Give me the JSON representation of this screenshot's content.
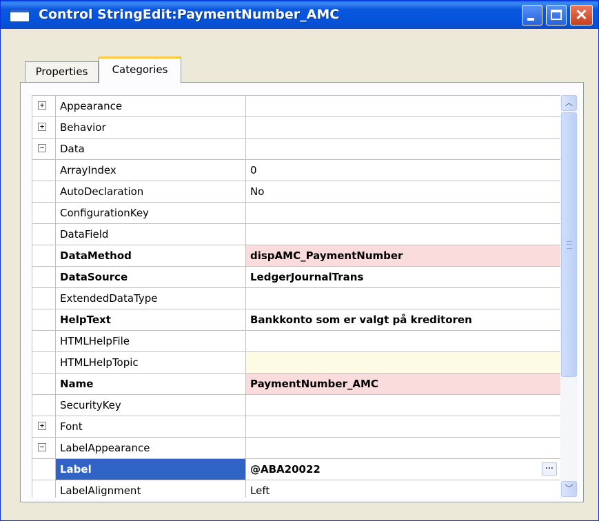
{
  "window": {
    "title": "Control StringEdit:PaymentNumber_AMC"
  },
  "tabs": [
    {
      "label": "Properties"
    },
    {
      "label": "Categories"
    }
  ],
  "rows": [
    {
      "toggle": "+",
      "name": "Appearance",
      "value": ""
    },
    {
      "toggle": "+",
      "name": "Behavior",
      "value": ""
    },
    {
      "toggle": "−",
      "name": "Data",
      "value": ""
    },
    {
      "toggle": "",
      "name": "ArrayIndex",
      "value": "0"
    },
    {
      "toggle": "",
      "name": "AutoDeclaration",
      "value": "No"
    },
    {
      "toggle": "",
      "name": "ConfigurationKey",
      "value": ""
    },
    {
      "toggle": "",
      "name": "DataField",
      "value": ""
    },
    {
      "toggle": "",
      "name": "DataMethod",
      "value": "dispAMC_PaymentNumber",
      "bold": true,
      "highlight": "pink"
    },
    {
      "toggle": "",
      "name": "DataSource",
      "value": "LedgerJournalTrans",
      "bold": true
    },
    {
      "toggle": "",
      "name": "ExtendedDataType",
      "value": ""
    },
    {
      "toggle": "",
      "name": "HelpText",
      "value": "Bankkonto som er valgt på kreditoren",
      "bold": true
    },
    {
      "toggle": "",
      "name": "HTMLHelpFile",
      "value": ""
    },
    {
      "toggle": "",
      "name": "HTMLHelpTopic",
      "value": "",
      "highlight": "yellow"
    },
    {
      "toggle": "",
      "name": "Name",
      "value": "PaymentNumber_AMC",
      "bold": true,
      "highlight": "pink"
    },
    {
      "toggle": "",
      "name": "SecurityKey",
      "value": ""
    },
    {
      "toggle": "+",
      "name": "Font",
      "value": ""
    },
    {
      "toggle": "−",
      "name": "LabelAppearance",
      "value": ""
    },
    {
      "toggle": "",
      "name": "Label",
      "value": "@ABA20022",
      "bold": true,
      "selected": true,
      "button": "..."
    },
    {
      "toggle": "",
      "name": "LabelAlignment",
      "value": "Left"
    }
  ]
}
